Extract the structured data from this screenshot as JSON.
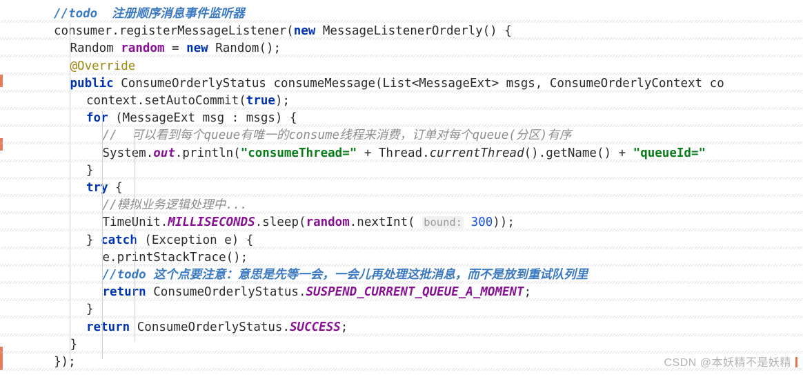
{
  "editor": {
    "language": "java",
    "background_color": "#ffffff",
    "default_text_color": "#2b2b2b",
    "accent_colors": {
      "keyword": "#0033b3",
      "string": "#067d17",
      "number": "#1750eb",
      "field": "#871094",
      "annotation": "#9e880d",
      "comment": "#8c8c8c",
      "todo": "#3a79c2",
      "change_marker": "#e77d5a",
      "param_hint": "#999999"
    }
  },
  "code": {
    "lines": [
      {
        "id": "line-todo-comment",
        "indent": 0,
        "tokens": [
          {
            "type": "todo",
            "text": "//todo"
          },
          {
            "type": "todotxt",
            "text": "  注册顺序消息事件监听器"
          }
        ]
      },
      {
        "id": "line-register-listener",
        "indent": 0,
        "tokens": [
          {
            "type": "plain",
            "text": "consumer.registerMessageListener("
          },
          {
            "type": "kw",
            "text": "new"
          },
          {
            "type": "plain",
            "text": " MessageListenerOrderly() {"
          }
        ]
      },
      {
        "id": "line-random-decl",
        "indent": 1,
        "tokens": [
          {
            "type": "plain",
            "text": "Random "
          },
          {
            "type": "field",
            "text": "random"
          },
          {
            "type": "plain",
            "text": " = "
          },
          {
            "type": "kw",
            "text": "new"
          },
          {
            "type": "plain",
            "text": " Random();"
          }
        ]
      },
      {
        "id": "line-override",
        "indent": 1,
        "tokens": [
          {
            "type": "anno",
            "text": "@Override"
          }
        ]
      },
      {
        "id": "line-consume-message-signature",
        "indent": 1,
        "tokens": [
          {
            "type": "kw",
            "text": "public"
          },
          {
            "type": "plain",
            "text": " ConsumeOrderlyStatus consumeMessage(List<MessageExt> msgs, ConsumeOrderlyContext co"
          }
        ]
      },
      {
        "id": "line-set-auto-commit",
        "indent": 2,
        "tokens": [
          {
            "type": "plain",
            "text": "context.setAutoCommit("
          },
          {
            "type": "kw",
            "text": "true"
          },
          {
            "type": "plain",
            "text": ");"
          }
        ]
      },
      {
        "id": "line-for-loop",
        "indent": 2,
        "tokens": [
          {
            "type": "kw",
            "text": "for"
          },
          {
            "type": "plain",
            "text": " (MessageExt msg : msgs) {"
          }
        ]
      },
      {
        "id": "line-queue-comment",
        "indent": 3,
        "tokens": [
          {
            "type": "cmt",
            "text": "//  可以看到每个queue有唯一的consume线程来消费，订单对每个queue(分区)有序"
          }
        ]
      },
      {
        "id": "line-println",
        "indent": 3,
        "tokens": [
          {
            "type": "plain",
            "text": "System."
          },
          {
            "type": "static",
            "text": "out"
          },
          {
            "type": "plain",
            "text": ".println("
          },
          {
            "type": "str",
            "text": "\"consumeThread=\""
          },
          {
            "type": "plain",
            "text": " + Thread."
          },
          {
            "type": "statfn",
            "text": "currentThread"
          },
          {
            "type": "plain",
            "text": "().getName() + "
          },
          {
            "type": "str",
            "text": "\"queueId=\""
          }
        ]
      },
      {
        "id": "line-close-for",
        "indent": 2,
        "tokens": [
          {
            "type": "plain",
            "text": "}"
          }
        ]
      },
      {
        "id": "line-try",
        "indent": 2,
        "tokens": [
          {
            "type": "kw",
            "text": "try"
          },
          {
            "type": "plain",
            "text": " {"
          }
        ]
      },
      {
        "id": "line-business-comment",
        "indent": 3,
        "tokens": [
          {
            "type": "cmt",
            "text": "//模拟业务逻辑处理中..."
          }
        ]
      },
      {
        "id": "line-sleep",
        "indent": 3,
        "tokens": [
          {
            "type": "plain",
            "text": "TimeUnit."
          },
          {
            "type": "static",
            "text": "MILLISECONDS"
          },
          {
            "type": "plain",
            "text": ".sleep("
          },
          {
            "type": "field",
            "text": "random"
          },
          {
            "type": "plain",
            "text": ".nextInt( "
          },
          {
            "type": "hint",
            "text": "bound:"
          },
          {
            "type": "plain",
            "text": " "
          },
          {
            "type": "num",
            "text": "300"
          },
          {
            "type": "plain",
            "text": "));"
          }
        ]
      },
      {
        "id": "line-catch",
        "indent": 2,
        "tokens": [
          {
            "type": "plain",
            "text": "} "
          },
          {
            "type": "kw",
            "text": "catch"
          },
          {
            "type": "plain",
            "text": " (Exception e) {"
          }
        ]
      },
      {
        "id": "line-print-stack-trace",
        "indent": 3,
        "tokens": [
          {
            "type": "plain",
            "text": "e.printStackTrace();"
          }
        ]
      },
      {
        "id": "line-todo-note",
        "indent": 3,
        "tokens": [
          {
            "type": "todo",
            "text": "//todo"
          },
          {
            "type": "todotxt",
            "text": " 这个点要注意：意思是先等一会，一会儿再处理这批消息，而不是放到重试队列里"
          }
        ]
      },
      {
        "id": "line-return-suspend",
        "indent": 3,
        "tokens": [
          {
            "type": "kw",
            "text": "return"
          },
          {
            "type": "plain",
            "text": " ConsumeOrderlyStatus."
          },
          {
            "type": "static",
            "text": "SUSPEND_CURRENT_QUEUE_A_MOMENT"
          },
          {
            "type": "plain",
            "text": ";"
          }
        ]
      },
      {
        "id": "line-close-catch",
        "indent": 2,
        "tokens": [
          {
            "type": "plain",
            "text": "}"
          }
        ]
      },
      {
        "id": "line-return-success",
        "indent": 2,
        "tokens": [
          {
            "type": "kw",
            "text": "return"
          },
          {
            "type": "plain",
            "text": " ConsumeOrderlyStatus."
          },
          {
            "type": "static",
            "text": "SUCCESS"
          },
          {
            "type": "plain",
            "text": ";"
          }
        ]
      },
      {
        "id": "line-close-method",
        "indent": 1,
        "tokens": [
          {
            "type": "plain",
            "text": "}"
          }
        ]
      },
      {
        "id": "line-close-call",
        "indent": 0,
        "tokens": [
          {
            "type": "plain",
            "text": "});"
          }
        ]
      }
    ]
  },
  "watermark": {
    "text": "CSDN @本妖精不是妖精"
  }
}
